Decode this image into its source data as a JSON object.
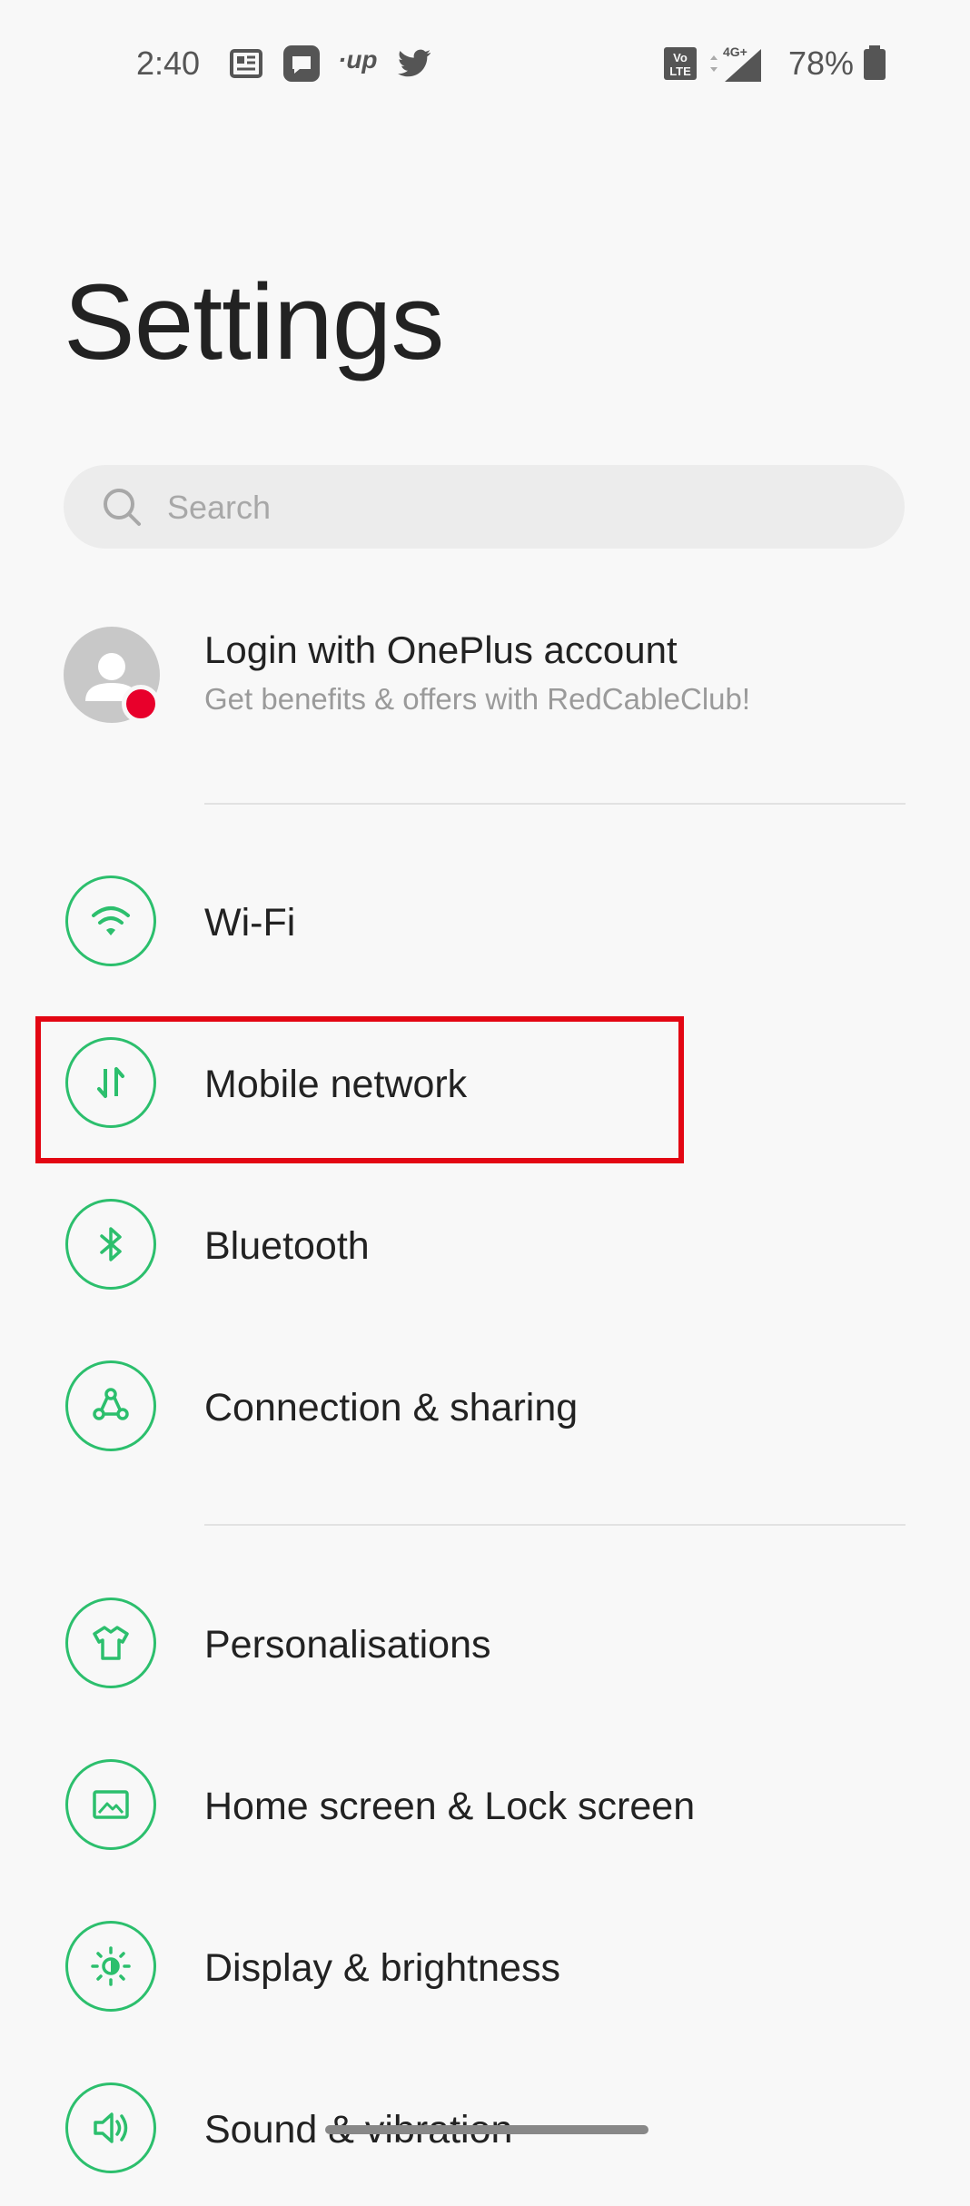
{
  "statusbar": {
    "time": "2:40",
    "up_label": "·up",
    "battery": "78%",
    "icons": [
      "news-icon",
      "messaging-icon",
      "up-icon",
      "twitter-icon",
      "volte-icon",
      "signal-4g-icon",
      "battery-icon"
    ],
    "network": "4G+"
  },
  "page": {
    "title": "Settings"
  },
  "search": {
    "placeholder": "Search"
  },
  "account": {
    "title": "Login with OnePlus account",
    "subtitle": "Get benefits & offers with RedCableClub!"
  },
  "items": [
    {
      "label": "Wi-Fi",
      "icon": "wifi-icon"
    },
    {
      "label": "Mobile network",
      "icon": "mobile-data-icon"
    },
    {
      "label": "Bluetooth",
      "icon": "bluetooth-icon"
    },
    {
      "label": "Connection & sharing",
      "icon": "connection-sharing-icon"
    },
    {
      "label": "Personalisations",
      "icon": "tshirt-icon"
    },
    {
      "label": "Home screen & Lock screen",
      "icon": "wallpaper-icon"
    },
    {
      "label": "Display & brightness",
      "icon": "brightness-icon"
    },
    {
      "label": "Sound & vibration",
      "icon": "speaker-icon"
    }
  ],
  "colors": {
    "accent": "#2cbf6d",
    "highlight": "#e30613",
    "badge": "#e8002b",
    "background": "#f8f8f8"
  }
}
